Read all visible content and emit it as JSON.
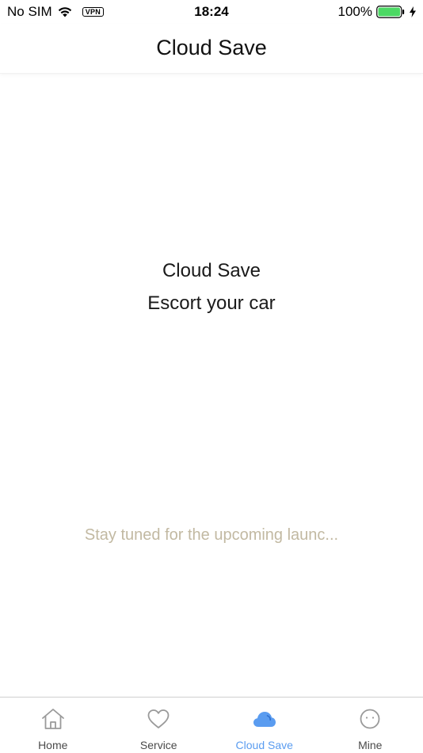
{
  "status_bar": {
    "carrier": "No SIM",
    "vpn": "VPN",
    "time": "18:24",
    "battery_percent": "100%",
    "battery_level": 1.0,
    "battery_color": "#4cd964",
    "icons": [
      "wifi-icon",
      "battery-icon",
      "charging-bolt-icon"
    ]
  },
  "nav": {
    "title": "Cloud Save"
  },
  "main": {
    "title": "Cloud Save",
    "subtitle": "Escort your car",
    "notice": "Stay tuned for the upcoming launc..."
  },
  "tab_bar": {
    "active_color": "#5a9cf0",
    "inactive_color": "#4a4a4a",
    "items": [
      {
        "label": "Home",
        "icon": "home-icon",
        "active": false
      },
      {
        "label": "Service",
        "icon": "heart-icon",
        "active": false
      },
      {
        "label": "Cloud Save",
        "icon": "cloud-icon",
        "active": true
      },
      {
        "label": "Mine",
        "icon": "face-icon",
        "active": false
      }
    ]
  }
}
